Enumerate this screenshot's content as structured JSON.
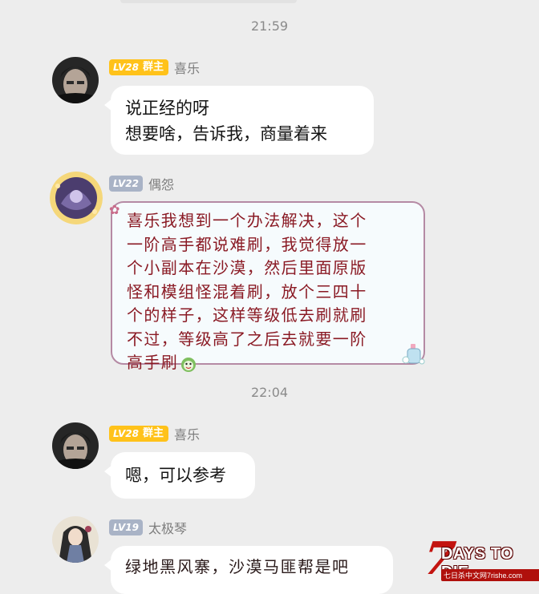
{
  "timestamps": [
    "21:59",
    "22:04"
  ],
  "messages": [
    {
      "level": "LV28",
      "role": "群主",
      "sender": "喜乐",
      "lines": [
        "说正经的呀",
        "想要啥，告诉我，商量着来"
      ]
    },
    {
      "level": "LV22",
      "sender": "偶怨",
      "lines": [
        "喜乐我想到一个办法解决，这个",
        "一阶高手都说难刷，我觉得放一",
        "个小副本在沙漠，然后里面原版",
        "怪和模组怪混着刷，放个三四十",
        "个的样子，这样等级低去刷就刷",
        "不过，等级高了之后去就要一阶",
        "高手刷"
      ]
    },
    {
      "level": "LV28",
      "role": "群主",
      "sender": "喜乐",
      "lines": [
        "嗯，可以参考"
      ]
    },
    {
      "level": "LV19",
      "sender": "太极琴",
      "lines": [
        "绿地黑风寨，沙漠马匪帮是吧"
      ]
    }
  ],
  "watermark": {
    "big": "7",
    "text": "DAYS TO DIE",
    "sub": "七日杀中文网7rishe.com"
  },
  "colors": {
    "background": "#ededed",
    "owner_badge": "#ffc21a",
    "level_badge_gray": "#a9b3c6",
    "fancy_text": "#8a1a24",
    "fancy_border": "#b58aa4"
  }
}
